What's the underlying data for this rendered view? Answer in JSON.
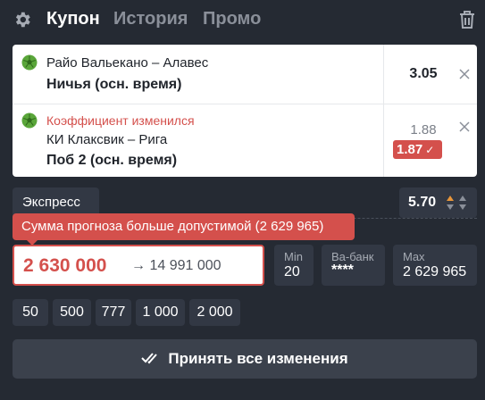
{
  "header": {
    "tabs": [
      {
        "label": "Купон",
        "active": true
      },
      {
        "label": "История",
        "active": false
      },
      {
        "label": "Промо",
        "active": false
      }
    ],
    "icons": {
      "settings": "gear-icon",
      "clear": "trash-icon"
    }
  },
  "bets": [
    {
      "sport_icon": "soccer-ball-icon",
      "match": "Райо Вальекано – Алавес",
      "outcome": "Ничья (осн. время)",
      "odd": "3.05"
    },
    {
      "sport_icon": "soccer-ball-icon",
      "notice": "Коэффициент изменился",
      "match": "КИ Клаксвик – Рига",
      "outcome": "Поб 2 (осн. время)",
      "odd_old": "1.88",
      "odd_new": "1.87",
      "odd_new_mark": "✓"
    }
  ],
  "bet_type": {
    "label": "Экспресс",
    "total_odd": "5.70"
  },
  "stake": {
    "error": "Сумма прогноза больше допустимой (2 629 965)",
    "value": "2 630 000",
    "arrow": "→",
    "possible_win": "14 991 000"
  },
  "limits": {
    "min": {
      "label": "Min",
      "value": "20"
    },
    "vabank": {
      "label": "Ва-банк",
      "value": "****"
    },
    "max": {
      "label": "Max",
      "value": "2 629 965"
    }
  },
  "quick_amounts": [
    "50",
    "500",
    "777",
    "1 000",
    "2 000"
  ],
  "accept_button": {
    "label": "Принять все изменения"
  },
  "colors": {
    "background": "#252a33",
    "panel": "#323844",
    "error": "#d4504c",
    "accent_up": "#e8963a",
    "ball_green": "#5aa63a"
  }
}
